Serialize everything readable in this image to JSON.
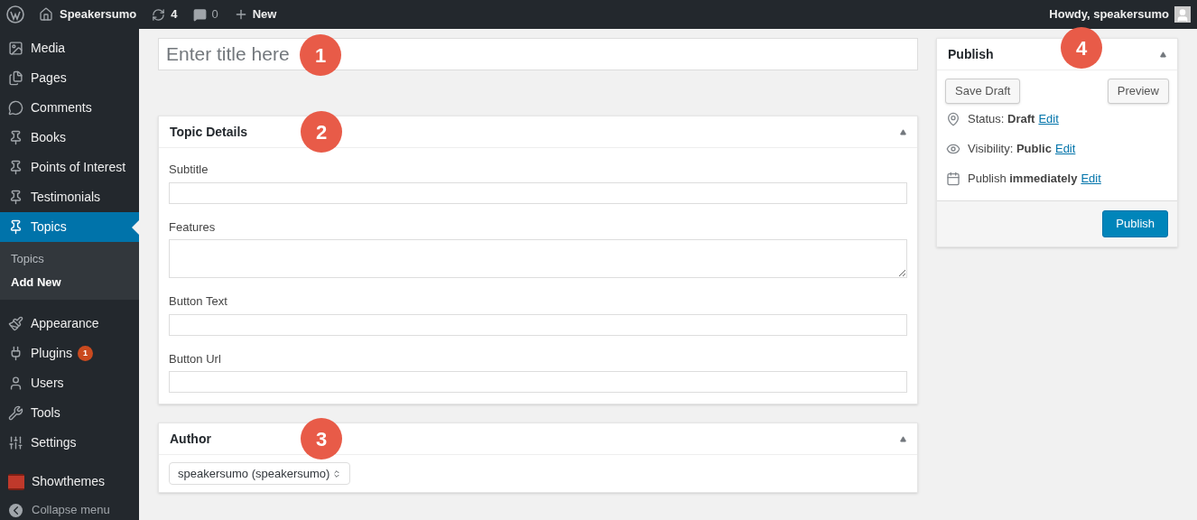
{
  "admin_bar": {
    "site_name": "Speakersumo",
    "updates": "4",
    "comments": "0",
    "new": "New",
    "greeting": "Howdy, speakersumo"
  },
  "sidebar": {
    "groups": [
      [
        {
          "label": "Media",
          "selected": false
        },
        {
          "label": "Pages",
          "selected": false
        },
        {
          "label": "Comments",
          "selected": false
        },
        {
          "label": "Books",
          "selected": false
        },
        {
          "label": "Points of Interest",
          "selected": false
        },
        {
          "label": "Testimonials",
          "selected": false
        },
        {
          "label": "Topics",
          "selected": true,
          "children": [
            {
              "label": "Topics",
              "selected": false
            },
            {
              "label": "Add New",
              "selected": true
            }
          ]
        }
      ],
      [
        {
          "label": "Appearance",
          "selected": false
        },
        {
          "label": "Plugins",
          "selected": false,
          "badge": "1"
        },
        {
          "label": "Users",
          "selected": false
        },
        {
          "label": "Tools",
          "selected": false
        },
        {
          "label": "Settings",
          "selected": false
        }
      ],
      [
        {
          "label": "Showthemes",
          "selected": false
        }
      ]
    ],
    "collapse_menu": "Collapse menu"
  },
  "title_field": {
    "placeholder": "Enter title here",
    "callout": "1"
  },
  "topic_details": {
    "title": "Topic Details",
    "callout": "2",
    "fields": [
      {
        "label": "Subtitle",
        "kind": "text"
      },
      {
        "label": "Features",
        "kind": "textarea"
      },
      {
        "label": "Button Text",
        "kind": "text"
      },
      {
        "label": "Button Url",
        "kind": "text"
      }
    ]
  },
  "author": {
    "title": "Author",
    "callout": "3",
    "value": "speakersumo (speakersumo)"
  },
  "publish": {
    "title": "Publish",
    "callout": "4",
    "save_draft": "Save Draft",
    "preview": "Preview",
    "rows": [
      {
        "text": "Status: **Draft**",
        "link": "Edit"
      },
      {
        "text": "Visibility: **Public**",
        "link": "Edit"
      },
      {
        "text": "Publish **immediately**",
        "link": "Edit"
      }
    ],
    "publish_button": "Publish"
  }
}
